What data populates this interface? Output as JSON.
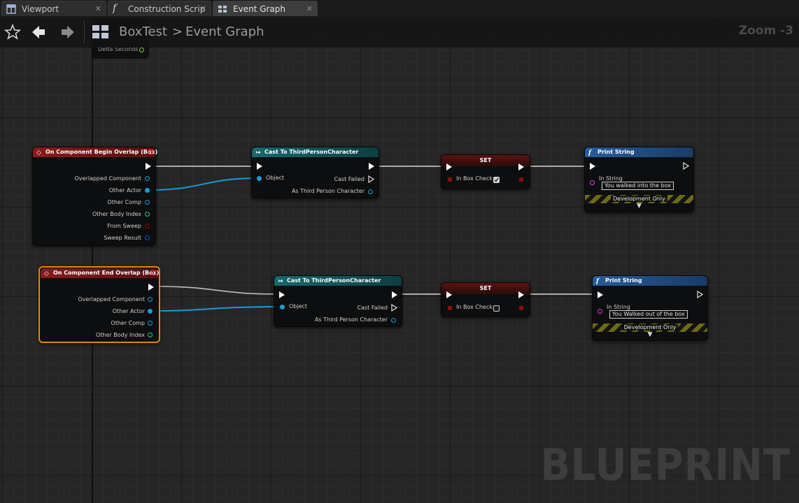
{
  "tabs": [
    {
      "label": "Viewport",
      "icon": "viewport-icon",
      "active": false
    },
    {
      "label": "Construction Scrip",
      "icon": "function-icon",
      "active": false
    },
    {
      "label": "Event Graph",
      "icon": "event-graph-icon",
      "active": true
    }
  ],
  "toolbar": {
    "breadcrumb_root": "BoxTest",
    "breadcrumb_separator": ">",
    "breadcrumb_current": "Event Graph",
    "zoom": "Zoom -3"
  },
  "tick_node": {
    "pin_label": "Delta Seconds"
  },
  "row1": {
    "begin_overlap": {
      "title": "On Component Begin Overlap (Box)",
      "pins": [
        "Overlapped Component",
        "Other Actor",
        "Other Comp",
        "Other Body Index",
        "From Sweep",
        "Sweep Result"
      ]
    },
    "cast": {
      "title": "Cast To ThirdPersonCharacter",
      "object": "Object",
      "cast_failed": "Cast Failed",
      "as_char": "As Third Person Character"
    },
    "set": {
      "title": "SET",
      "var": "In Box Check",
      "checked": true
    },
    "print": {
      "title": "Print String",
      "in_string": "In String",
      "value": "You walked into the box",
      "dev_only": "Development Only"
    }
  },
  "row2": {
    "end_overlap": {
      "title": "On Component End Overlap (Box)",
      "pins": [
        "Overlapped Component",
        "Other Actor",
        "Other Comp",
        "Other Body Index"
      ]
    },
    "cast": {
      "title": "Cast To ThirdPersonCharacter",
      "object": "Object",
      "cast_failed": "Cast Failed",
      "as_char": "As Third Person Character"
    },
    "set": {
      "title": "SET",
      "var": "In Box Check",
      "checked": false
    },
    "print": {
      "title": "Print String",
      "in_string": "In String",
      "value": "You Walked out of the box",
      "dev_only": "Development Only"
    }
  },
  "watermark": "BLUEPRINT",
  "colors": {
    "exec_wire": "#d9d9d9",
    "object_wire": "#1a9ad6",
    "event_header": "#8c1a1a",
    "cast_header": "#15696d",
    "function_header": "#275c9a",
    "selection": "#e08a00"
  }
}
